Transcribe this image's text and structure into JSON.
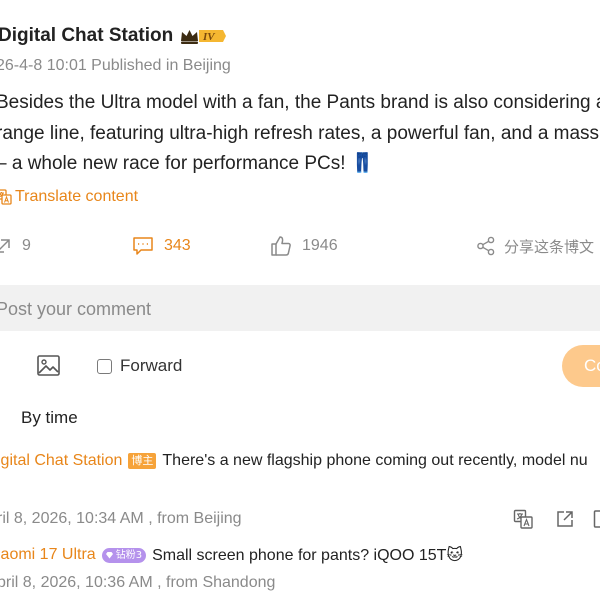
{
  "post": {
    "author": "Digital Chat Station",
    "vip_level": "IV",
    "meta": "26-4-8 10:01 Published in Beijing",
    "body_lines": [
      "Besides the Ultra model with a fan, the Pants brand is also considering a",
      "range line, featuring ultra-high refresh rates, a powerful fan, and a massiv",
      "– a whole new race for performance PCs! 👖"
    ],
    "translate_label": "Translate content"
  },
  "actions": {
    "repost_count": "9",
    "comment_count": "343",
    "like_count": "1946",
    "share_label": "分享这条博文"
  },
  "composer": {
    "placeholder": "Post your comment",
    "forward_label": "Forward",
    "submit_label": "Co"
  },
  "sort": {
    "label": "By time"
  },
  "comments": [
    {
      "author": "igital Chat Station",
      "badge": "博主",
      "text": "There's a new flagship phone coming out recently, model nu",
      "meta": "ril 8, 2026, 10:34 AM , from Beijing"
    },
    {
      "author": "iaomi 17 Ultra",
      "badge": "钻粉3",
      "text": "Small screen phone for pants? iQOO 15T🐱",
      "meta": "pril 8, 2026, 10:36 AM , from Shandong"
    }
  ],
  "colors": {
    "accent": "#e8861a",
    "muted": "#8a8a8a",
    "input_bg": "#f1f1f1",
    "submit_bg": "#fdc98c",
    "host_badge": "#f6a33a",
    "fan_badge": "#b592ec"
  },
  "icons": {
    "vip": "crown-icon",
    "translate": "translate-icon",
    "repost": "repost-icon",
    "comment": "comment-icon",
    "like": "thumbs-up-icon",
    "share": "share-icon",
    "image": "image-icon",
    "comment_translate": "translate-icon",
    "comment_share": "external-share-icon"
  }
}
